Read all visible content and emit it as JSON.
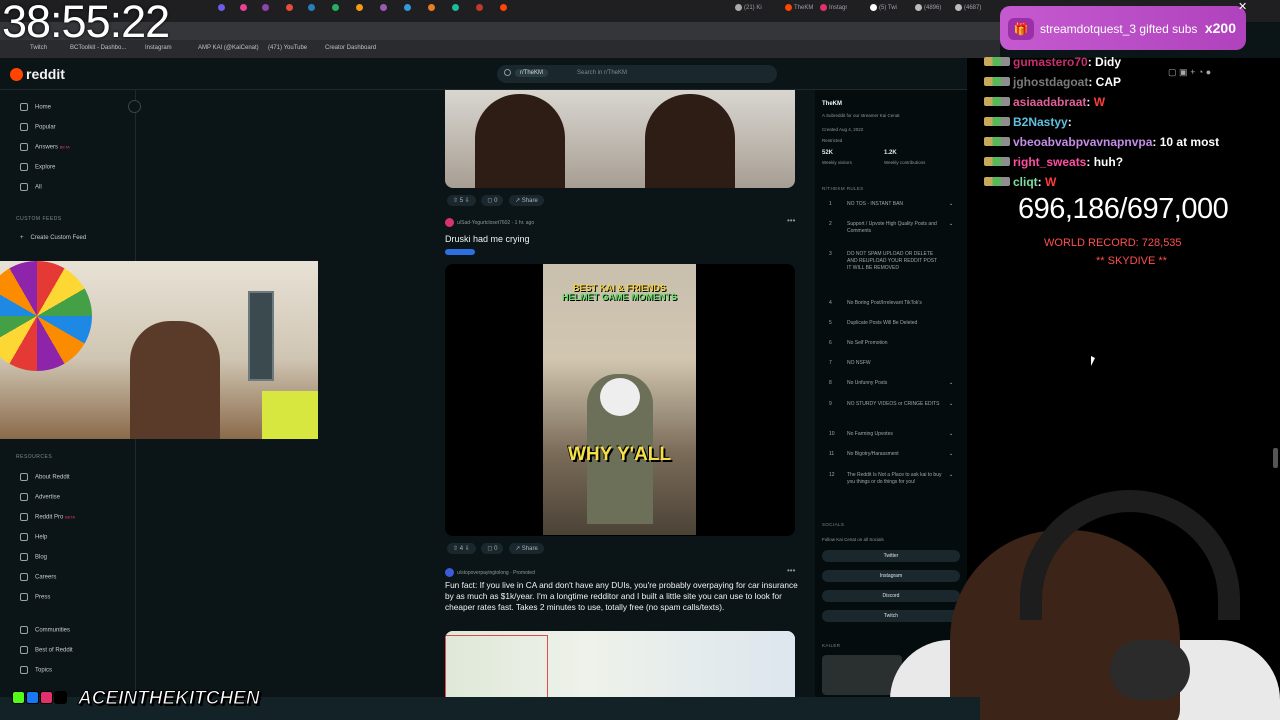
{
  "overlay": {
    "timer": "38:55:22",
    "watermark": "ACEINTHEKITCHEN",
    "subgoal": "696,186/697,000",
    "world_record": "WORLD RECORD: 728,535",
    "skydive": "** SKYDIVE **",
    "gift": {
      "user": "streamdotquest_3",
      "text": "streamdotquest_3 gifted subs",
      "count": "x200"
    }
  },
  "chat": [
    {
      "user": "gumastero70",
      "msg": "Didy"
    },
    {
      "user": "jghostdagoat",
      "msg": "CAP"
    },
    {
      "user": "asiaadabraat",
      "msg": "W"
    },
    {
      "user": "B2Nastyy",
      "msg": ""
    },
    {
      "user": "vbeoabvabpvavnapnvpa",
      "msg": "10 at most"
    },
    {
      "user": "right_sweats",
      "msg": "huh?"
    },
    {
      "user": "cliqt",
      "msg": "W"
    }
  ],
  "browser": {
    "tabs": [
      "",
      "",
      "",
      "",
      "",
      "",
      "",
      "",
      "",
      "",
      "",
      "",
      "",
      "(21) Ki",
      "TheKM",
      "Instagr",
      "(5) Twi",
      "(4896)",
      "(4687)"
    ],
    "bookmarks": [
      "Twitch",
      "BCToolkit - Dashbo...",
      "Instagram",
      "AMP KAI (@KaiCenat)",
      "(471) YouTube",
      "Creator Dashboard"
    ]
  },
  "reddit": {
    "brand": "reddit",
    "search_chip": "r/TheKM",
    "search_placeholder": "Search in r/TheKM",
    "nav": {
      "home": "Home",
      "popular": "Popular",
      "answers": "Answers",
      "answers_badge": "BETA",
      "explore": "Explore",
      "all": "All",
      "custom_feeds_head": "CUSTOM FEEDS",
      "create_feed": "Create Custom Feed",
      "resources_head": "RESOURCES",
      "about": "About Reddit",
      "advertise": "Advertise",
      "pro": "Reddit Pro",
      "pro_badge": "BETA",
      "help": "Help",
      "blog": "Blog",
      "careers": "Careers",
      "press": "Press",
      "communities": "Communities",
      "best": "Best of Reddit",
      "topics": "Topics"
    },
    "post1": {
      "votes": "5",
      "comments": "0",
      "share": "Share"
    },
    "post2": {
      "author": "u/Sad-Yogurtcloset7602",
      "age": "1 hr. ago",
      "title": "Druski had me crying",
      "video_title_1": "BEST KAI & FRIENDS",
      "video_title_2": "HELMET GAME MOMENTS",
      "video_caption": "WHY Y'ALL",
      "votes": "4",
      "comments": "0",
      "share": "Share"
    },
    "promo": {
      "author": "u/stopoverpayingtolong",
      "tag": "Promoted",
      "text": "Fun fact: If you live in CA and don't have any DUIs, you're probably overpaying for car insurance by as much as $1k/year. I'm a longtime redditor and I built a little site you can use to look for cheaper rates fast. Takes 2 minutes to use, totally free (no spam calls/texts)."
    },
    "sidebar": {
      "title": "TheKM",
      "desc": "A Subreddit for our streamer Kai Cenat",
      "created": "Created Aug 4, 2022",
      "restricted": "Restricted",
      "visitors": "52K",
      "visitors_label": "Weekly visitors",
      "contrib": "1.2K",
      "contrib_label": "Weekly contributions",
      "rules_head": "R/THEKM RULES",
      "rules": [
        "NO TOS - INSTANT BAN",
        "Support / Upvote High Quality Posts and Comments",
        "DO NOT SPAM UPLOAD OR DELETE AND REUPLOAD YOUR REDDIT POST IT WILL BE REMOVED",
        "No Boring Post/Irrelevant TikTok's",
        "Duplicate Posts Will Be Deleted",
        "No Self Promotion",
        "NO NSFW",
        "No Unfunny Posts",
        "NO STURDY VIDEOS or CRINGE EDITS",
        "No Farming Upvotes",
        "No Bigotry/Harassment",
        "The Reddit Is Not a Place to ask kai to buy you things or do things for you!"
      ],
      "socials_head": "SOCIALS",
      "socials_desc": "Follow Kai Cenat on all Socials",
      "socials": [
        "Twitter",
        "Instagram",
        "Discord",
        "Twitch"
      ],
      "kailer": "KAILER"
    }
  }
}
